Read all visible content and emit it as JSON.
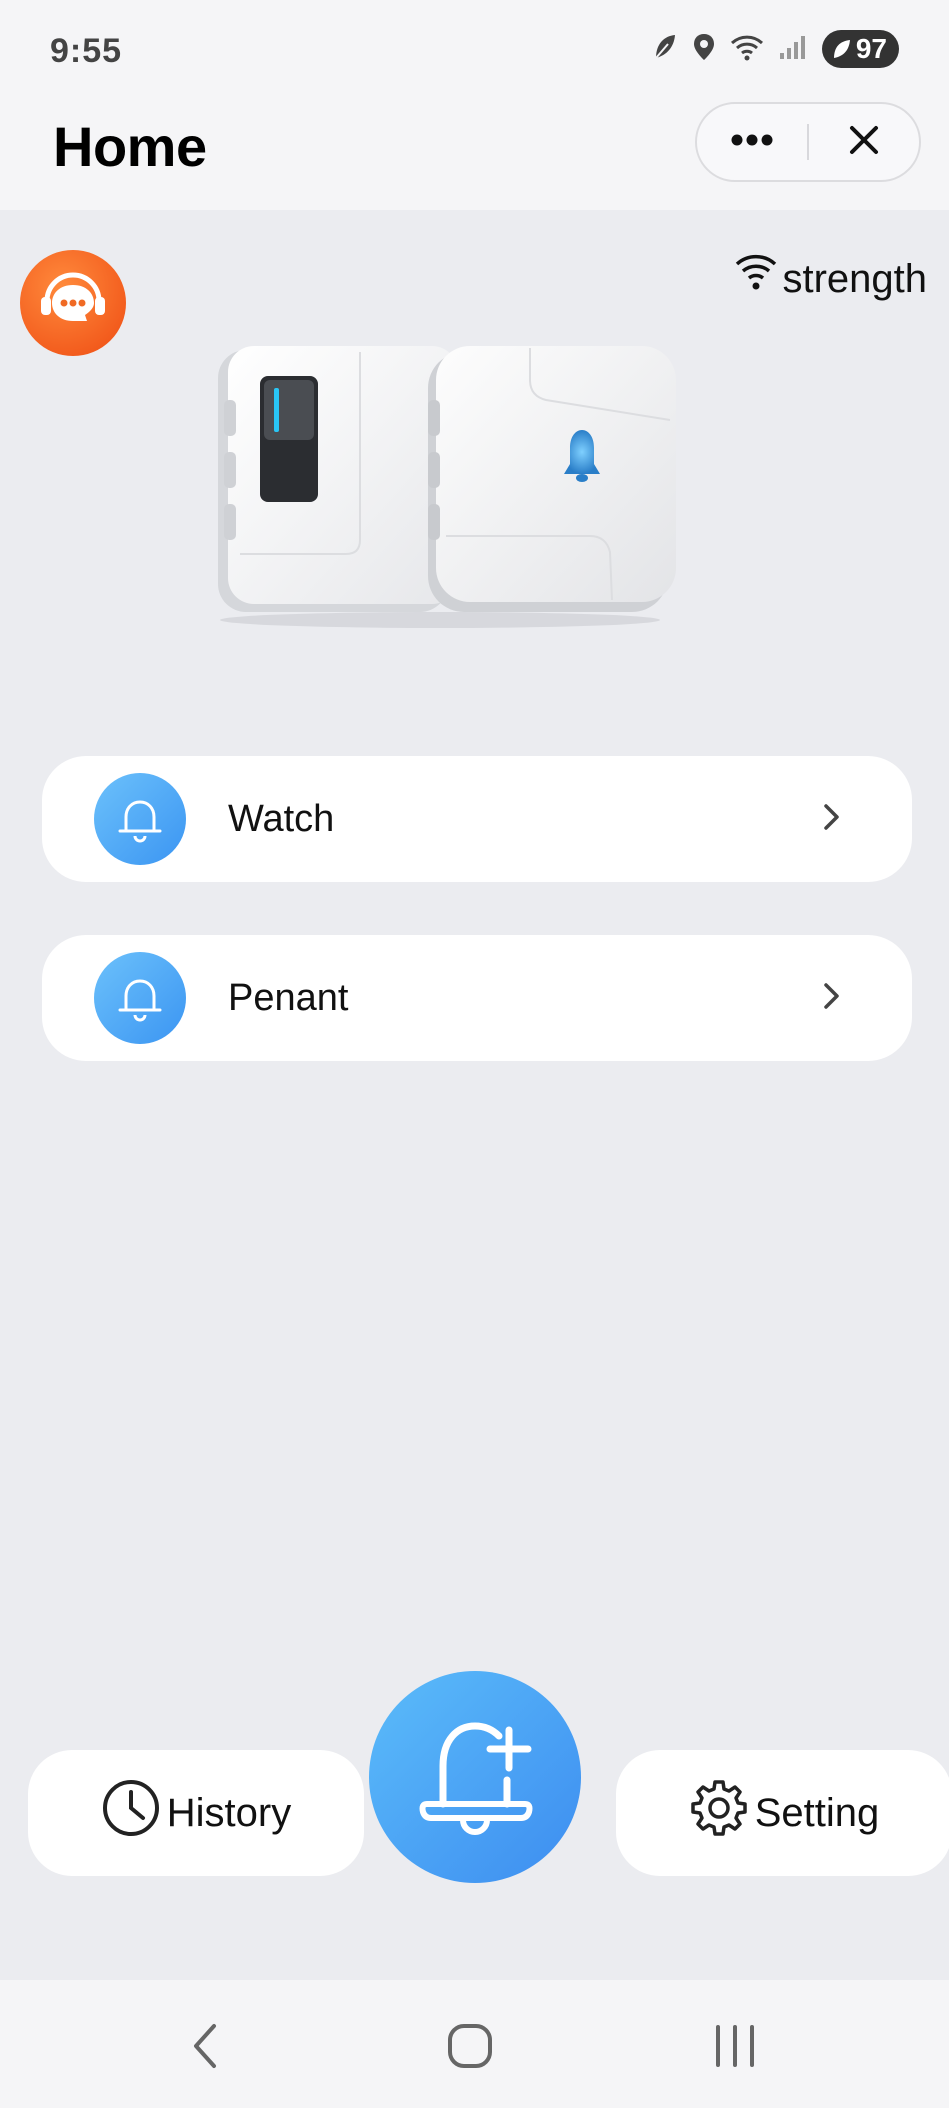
{
  "status_bar": {
    "time": "9:55",
    "battery_level": "97",
    "icons": [
      "leaf-icon",
      "location-icon",
      "wifi-icon",
      "signal-icon",
      "battery-icon"
    ]
  },
  "header": {
    "title": "Home",
    "more_icon": "more-dots-icon",
    "close_icon": "close-icon"
  },
  "main": {
    "support_icon": "customer-support-icon",
    "signal_label": "strength",
    "device_image": "doorbell-device-image",
    "menu": [
      {
        "label": "Watch",
        "icon": "bell-icon"
      },
      {
        "label": "Penant",
        "icon": "bell-icon"
      }
    ]
  },
  "bottom_actions": {
    "history_label": "History",
    "setting_label": "Setting",
    "add_icon": "bell-plus-icon"
  },
  "nav_bar": {
    "buttons": [
      "back-icon",
      "home-icon",
      "recents-icon"
    ]
  },
  "colors": {
    "accent_blue": "#3d8df0",
    "accent_light_blue": "#6cc1fb",
    "support_orange": "#ee4b12",
    "background": "#ebecf0"
  }
}
